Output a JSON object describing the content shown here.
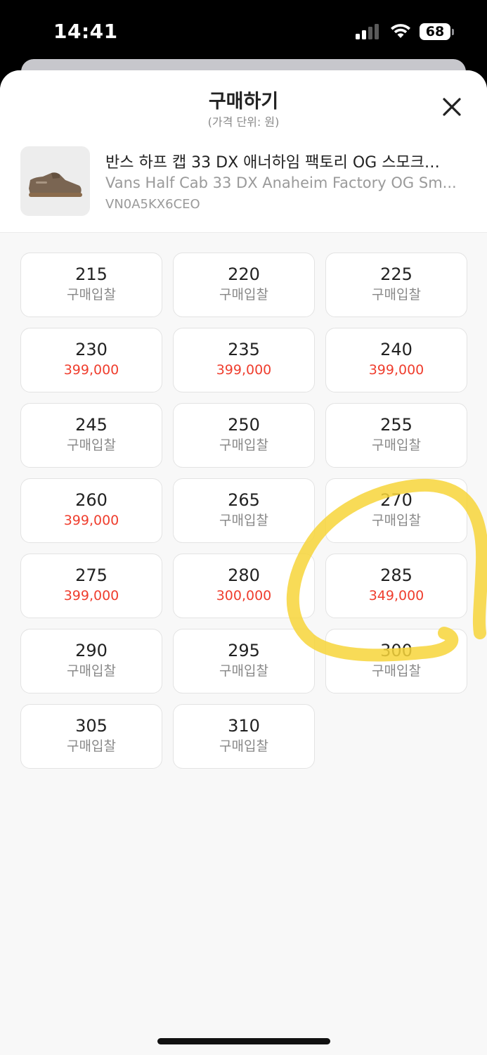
{
  "status_bar": {
    "time": "14:41",
    "battery": "68"
  },
  "sheet": {
    "title": "구매하기",
    "subtitle": "(가격 단위: 원)"
  },
  "product": {
    "name_ko": "반스 하프 캡 33 DX 애너하임 팩토리 OG 스모크…",
    "name_en": "Vans Half Cab 33 DX Anaheim Factory OG Sm...",
    "code": "VN0A5KX6CEO"
  },
  "sizes": [
    {
      "size": "215",
      "price": "구매입찰",
      "highlight": false
    },
    {
      "size": "220",
      "price": "구매입찰",
      "highlight": false
    },
    {
      "size": "225",
      "price": "구매입찰",
      "highlight": false
    },
    {
      "size": "230",
      "price": "399,000",
      "highlight": true
    },
    {
      "size": "235",
      "price": "399,000",
      "highlight": true
    },
    {
      "size": "240",
      "price": "399,000",
      "highlight": true
    },
    {
      "size": "245",
      "price": "구매입찰",
      "highlight": false
    },
    {
      "size": "250",
      "price": "구매입찰",
      "highlight": false
    },
    {
      "size": "255",
      "price": "구매입찰",
      "highlight": false
    },
    {
      "size": "260",
      "price": "399,000",
      "highlight": true
    },
    {
      "size": "265",
      "price": "구매입찰",
      "highlight": false
    },
    {
      "size": "270",
      "price": "구매입찰",
      "highlight": false
    },
    {
      "size": "275",
      "price": "399,000",
      "highlight": true
    },
    {
      "size": "280",
      "price": "300,000",
      "highlight": true
    },
    {
      "size": "285",
      "price": "349,000",
      "highlight": true
    },
    {
      "size": "290",
      "price": "구매입찰",
      "highlight": false
    },
    {
      "size": "295",
      "price": "구매입찰",
      "highlight": false
    },
    {
      "size": "300",
      "price": "구매입찰",
      "highlight": false
    },
    {
      "size": "305",
      "price": "구매입찰",
      "highlight": false
    },
    {
      "size": "310",
      "price": "구매입찰",
      "highlight": false
    }
  ],
  "colors": {
    "price_red": "#ef3e2e",
    "annotation_yellow": "#f7d53a"
  },
  "icons": {
    "close": "close-icon",
    "signal": "signal-icon",
    "wifi": "wifi-icon",
    "battery": "battery-icon"
  }
}
